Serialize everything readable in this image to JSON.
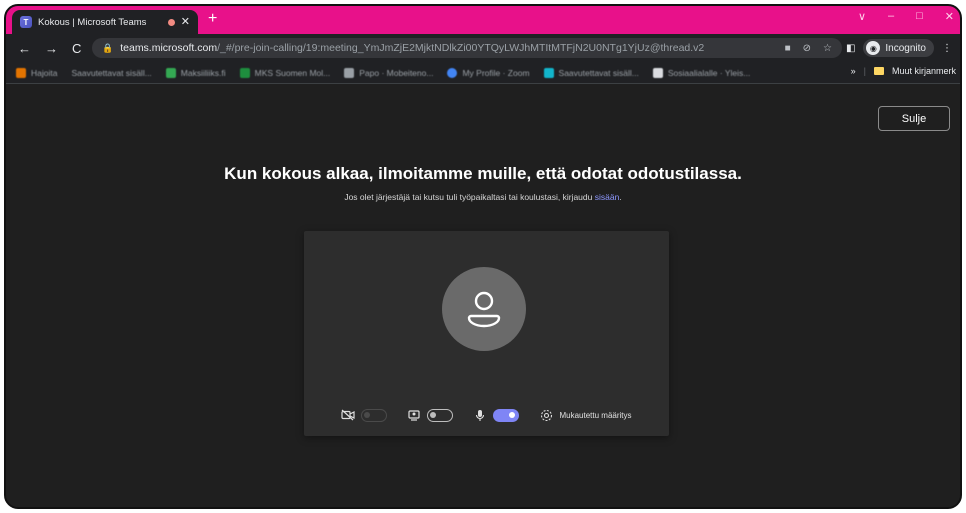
{
  "browser": {
    "tab": {
      "title": "Kokous | Microsoft Teams"
    },
    "new_tab": "+",
    "window_controls": [
      "∨",
      "–",
      "□",
      "✕"
    ],
    "nav": {
      "back": "←",
      "forward": "→",
      "reload": "C"
    },
    "url": {
      "host": "teams.microsoft.com",
      "path": "/_#/pre-join-calling/19:meeting_YmJmZjE2MjktNDlkZi00YTQyLWJhMTItMTFjN2U0NTg1YjUz@thread.v2"
    },
    "profile_label": "Incognito",
    "bookmarks": [
      "Hajoita",
      "Saavutettavat sisäll...",
      "Maksiiliiks.fi",
      "MKS Suomen Mol...",
      "Papo · Mobeiteno...",
      "My Profile · Zoom",
      "Saavutettavat sisäll...",
      "Sosiaalialalle · Yleis..."
    ],
    "bookmarks_more": "»",
    "other_bookmarks": "Muut kirjanmerk"
  },
  "page": {
    "close_label": "Sulje",
    "headline": "Kun kokous alkaa, ilmoitamme muille, että odotat odotustilassa.",
    "subline_text": "Jos olet järjestäjä tai kutsu tuli työpaikaltasi tai koulustasi, kirjaudu",
    "subline_link": "sisään",
    "subline_end": ".",
    "controls": {
      "custom_setup_label": "Mukautettu määritys"
    }
  },
  "colors": {
    "tab_strip": "#e8118a",
    "accent": "#7f85f5",
    "page_bg": "#1f1f1f"
  }
}
